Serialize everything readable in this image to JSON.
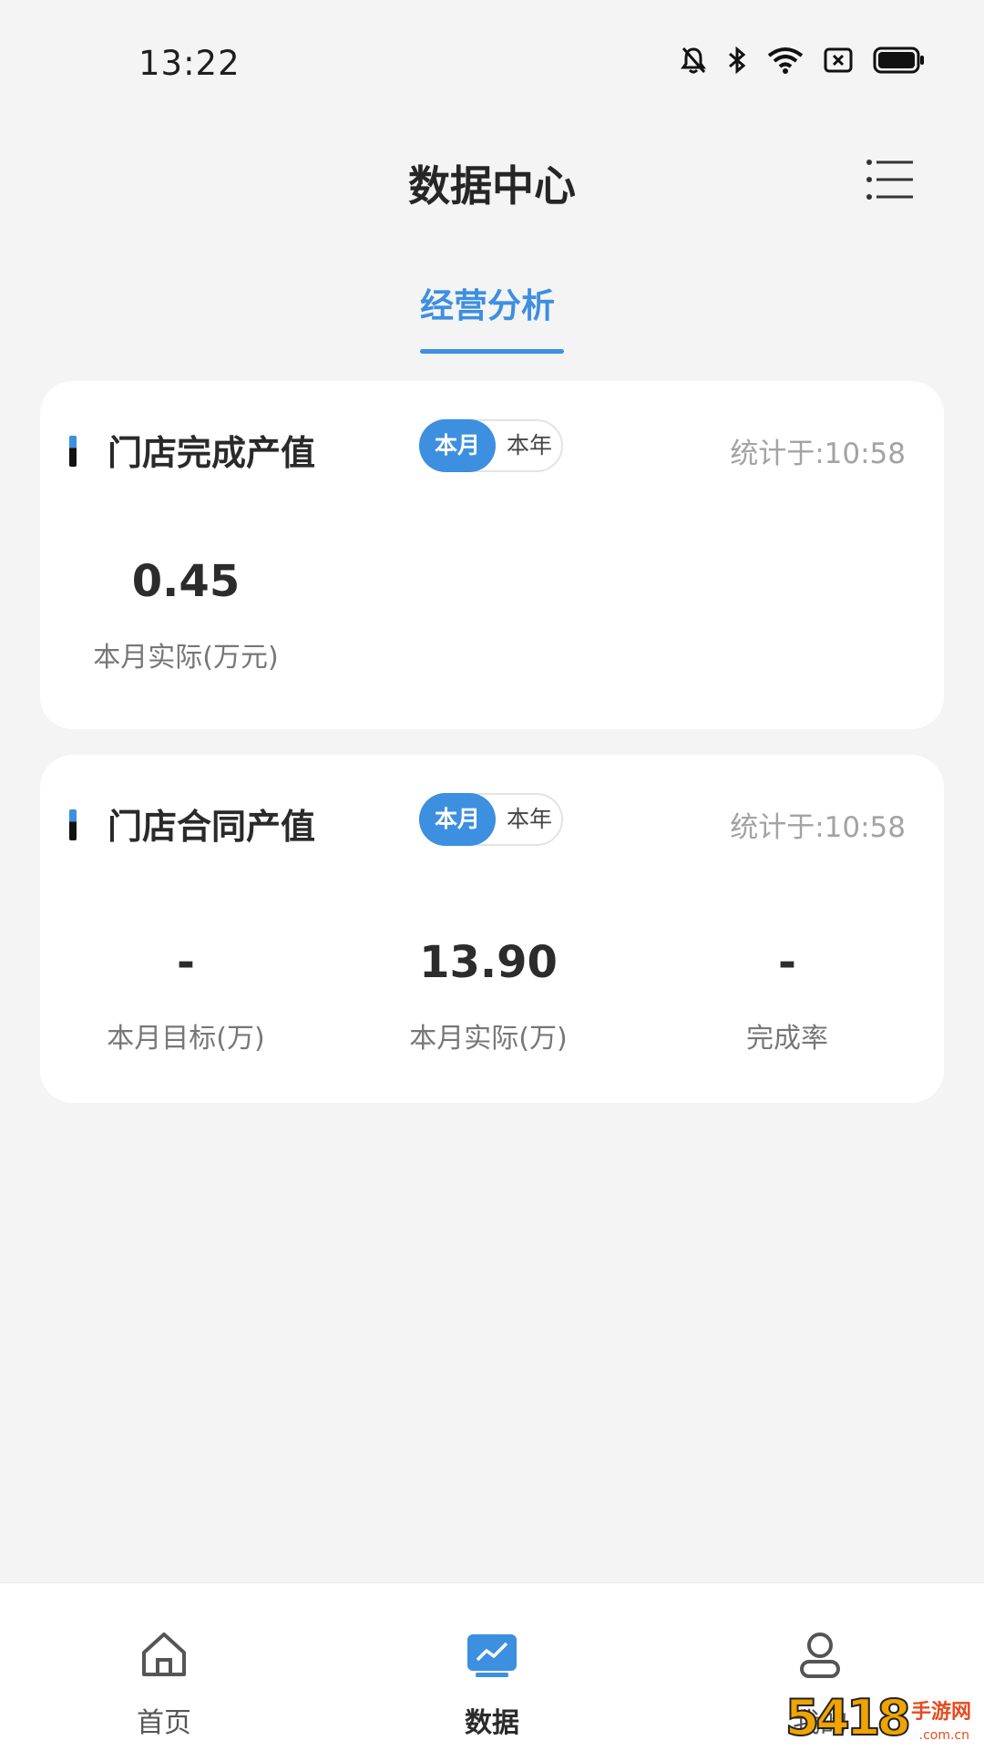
{
  "status_bar": {
    "time": "13:22",
    "icons": [
      "mute-bell-icon",
      "bluetooth-icon",
      "wifi-icon",
      "no-sim-icon",
      "battery-icon"
    ]
  },
  "header": {
    "title": "数据中心",
    "menu_icon": "list-menu-icon"
  },
  "tabs": [
    {
      "label": "经营分析",
      "active": true
    }
  ],
  "cards": [
    {
      "title": "门店完成产值",
      "toggle": {
        "month": "本月",
        "year": "本年",
        "selected": "本月"
      },
      "stat_time": "统计于:10:58",
      "metrics": [
        {
          "value": "0.45",
          "label": "本月实际(万元)"
        }
      ]
    },
    {
      "title": "门店合同产值",
      "toggle": {
        "month": "本月",
        "year": "本年",
        "selected": "本月"
      },
      "stat_time": "统计于:10:58",
      "metrics": [
        {
          "value": "-",
          "label": "本月目标(万)"
        },
        {
          "value": "13.90",
          "label": "本月实际(万)"
        },
        {
          "value": "-",
          "label": "完成率"
        }
      ]
    }
  ],
  "bottom_nav": [
    {
      "label": "首页",
      "icon": "home-icon",
      "active": false
    },
    {
      "label": "数据",
      "icon": "data-chart-icon",
      "active": true
    },
    {
      "label": "我的",
      "icon": "user-icon",
      "active": false
    }
  ],
  "colors": {
    "accent": "#3d8fe0",
    "background": "#f4f4f5",
    "card": "#ffffff"
  },
  "watermark": {
    "number": "5418",
    "text": "手游网",
    "domain": ".com.cn"
  }
}
